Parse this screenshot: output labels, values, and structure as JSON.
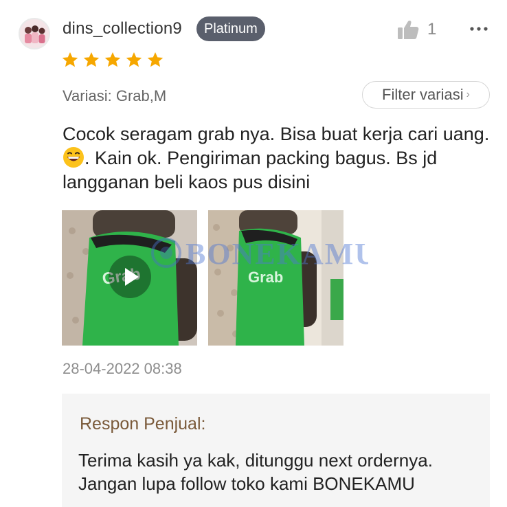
{
  "reviewer": {
    "username": "dins_collection9",
    "tier_badge": "Platinum",
    "avatar_icon": "user-avatar"
  },
  "likes": {
    "count": "1",
    "icon": "thumbs-up-icon"
  },
  "more_icon": "more-dots-icon",
  "rating": {
    "stars": 5,
    "max": 5,
    "color": "#f6a700"
  },
  "variant": {
    "label": "Variasi: Grab,M"
  },
  "filter_button": {
    "label": "Filter variasi"
  },
  "comment": {
    "part1": "Cocok seragam grab nya. Bisa buat kerja cari uang. ",
    "emoji": "grinning-face-emoji",
    "part2": ". Kain ok. Pengiriman packing bagus. Bs jd langganan beli kaos pus disini"
  },
  "media": [
    {
      "type": "video",
      "icon": "play-icon"
    },
    {
      "type": "image"
    }
  ],
  "watermark": {
    "text": "BONEKAMU"
  },
  "timestamp": "28-04-2022 08:38",
  "seller_response": {
    "title": "Respon Penjual:",
    "text": " Terima kasih ya kak, ditunggu next ordernya.\nJangan lupa follow toko kami BONEKAMU"
  },
  "colors": {
    "badge_bg": "#5a5f6c",
    "star": "#f6a700",
    "seller_title": "#7a5a3a",
    "seller_bg": "#f5f5f5",
    "shirt_green": "#2fb34a"
  }
}
